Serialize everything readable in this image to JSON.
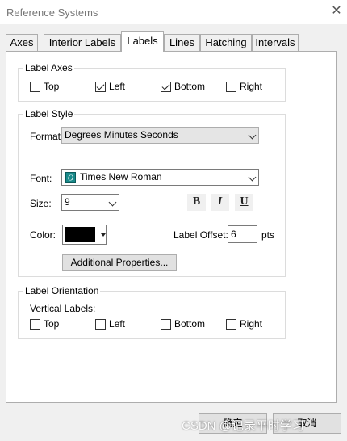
{
  "window": {
    "title": "Reference Systems"
  },
  "tabs": [
    {
      "label": "Axes"
    },
    {
      "label": "Interior Labels"
    },
    {
      "label": "Labels"
    },
    {
      "label": "Lines"
    },
    {
      "label": "Hatching"
    },
    {
      "label": "Intervals"
    }
  ],
  "active_tab": "Labels",
  "label_axes": {
    "title": "Label Axes",
    "items": [
      {
        "label": "Top",
        "checked": false
      },
      {
        "label": "Left",
        "checked": true
      },
      {
        "label": "Bottom",
        "checked": true
      },
      {
        "label": "Right",
        "checked": false
      }
    ]
  },
  "label_style": {
    "title": "Label Style",
    "format_label": "Format:",
    "format_value": "Degrees Minutes Seconds",
    "font_label": "Font:",
    "font_value": "Times New Roman",
    "size_label": "Size:",
    "size_value": "9",
    "bold": "B",
    "italic": "I",
    "underline": "U",
    "color_label": "Color:",
    "color_value": "#000000",
    "offset_label": "Label Offset:",
    "offset_value": "6",
    "offset_unit": "pts",
    "additional_button": "Additional Properties..."
  },
  "label_orientation": {
    "title": "Label Orientation",
    "vertical_label": "Vertical Labels:",
    "items": [
      {
        "label": "Top",
        "checked": false
      },
      {
        "label": "Left",
        "checked": false
      },
      {
        "label": "Bottom",
        "checked": false
      },
      {
        "label": "Right",
        "checked": false
      }
    ]
  },
  "footer": {
    "ok": "确定",
    "cancel": "取消"
  },
  "watermark": "CSDN @记录平时学习"
}
